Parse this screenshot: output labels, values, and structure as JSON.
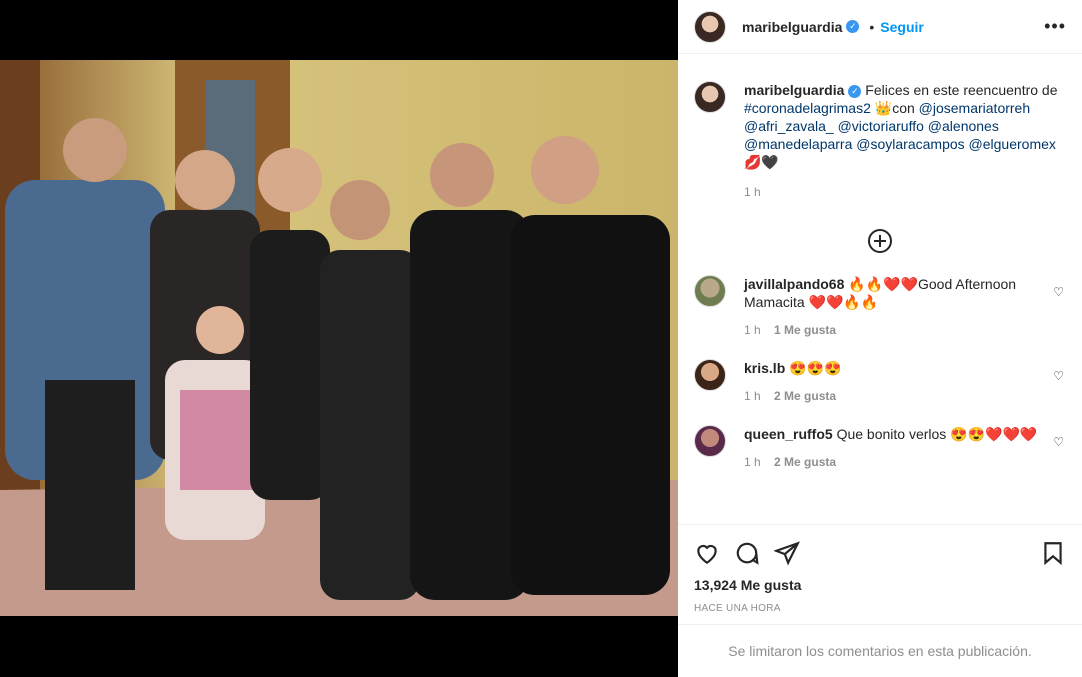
{
  "post": {
    "username": "maribelguardia",
    "follow_label": "Seguir",
    "more_label": "•••"
  },
  "caption": {
    "username": "maribelguardia",
    "text_before": "Felices en este reencuentro de",
    "hashtag": "#coronadelagrimas2",
    "crown_emoji": "👑",
    "con": "con",
    "mentions": "@josemariatorreh @afri_zavala_ @victoriaruffo @alenones @manedelaparra @soylaracampos @elgueromex",
    "emoji_tail": "💋🖤",
    "time": "1 h"
  },
  "comments": [
    {
      "username": "javillalpando68",
      "text": "🔥🔥❤️❤️Good Afternoon Mamacita ❤️❤️🔥🔥",
      "time": "1 h",
      "likes": "1 Me gusta"
    },
    {
      "username": "kris.lb",
      "text": "😍😍😍",
      "time": "1 h",
      "likes": "2 Me gusta"
    },
    {
      "username": "queen_ruffo5",
      "text": "Que bonito verlos 😍😍❤️❤️❤️",
      "time": "1 h",
      "likes": "2 Me gusta"
    }
  ],
  "footer": {
    "likes": "13,924 Me gusta",
    "ago": "HACE UNA HORA",
    "limited": "Se limitaron los comentarios en esta publicación."
  },
  "icons": [
    "like-icon",
    "comment-icon",
    "share-icon",
    "save-icon",
    "load-more-icon"
  ]
}
